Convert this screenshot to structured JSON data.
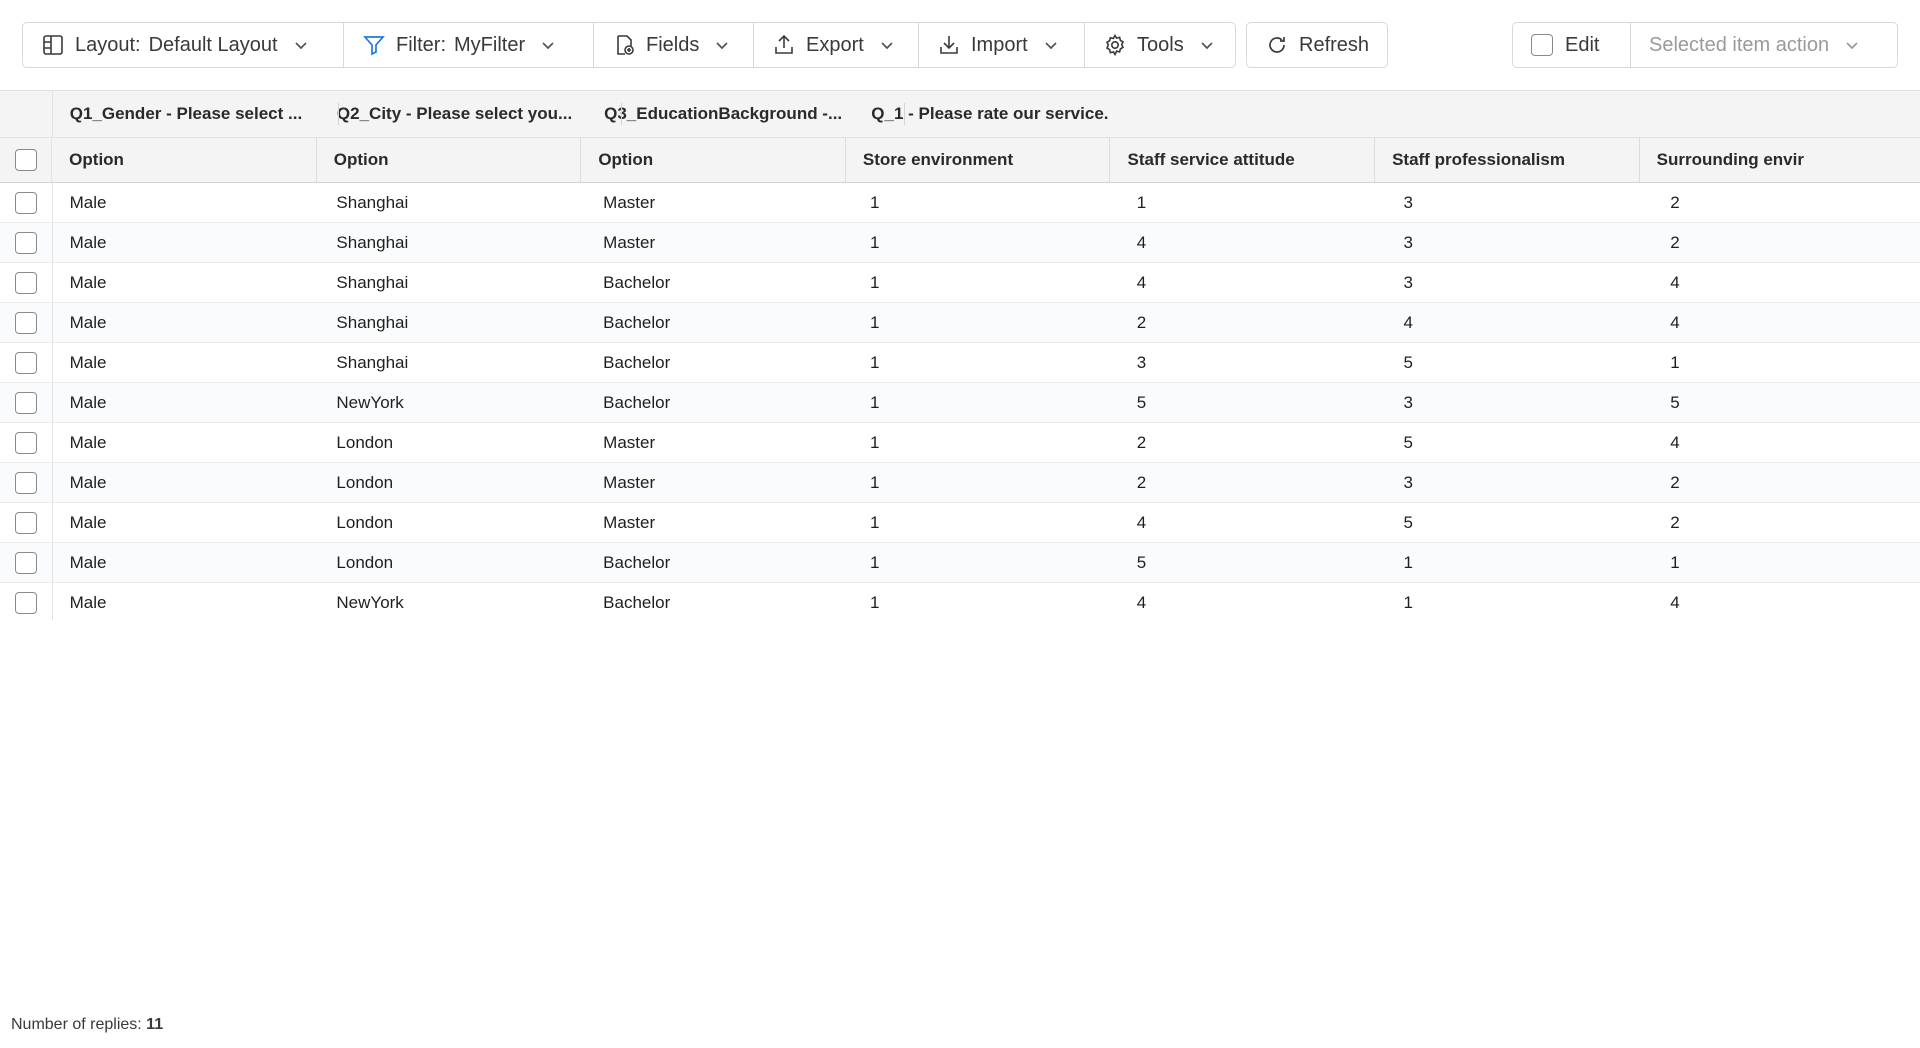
{
  "toolbar": {
    "layout": {
      "key": "Layout:",
      "value": "Default Layout"
    },
    "filter": {
      "key": "Filter:",
      "value": "MyFilter"
    },
    "fields": "Fields",
    "export": "Export",
    "import": "Import",
    "tools": "Tools",
    "refresh": "Refresh",
    "edit": "Edit",
    "selected_action": "Selected item action"
  },
  "accent_color": "#1f7ae0",
  "groups": [
    "Q1_Gender - Please select ...",
    "Q2_City - Please select you...",
    "Q3_EducationBackground -...",
    "Q_1 - Please rate our service."
  ],
  "headers": [
    "Option",
    "Option",
    "Option",
    "Store environment",
    "Staff service attitude",
    "Staff professionalism",
    "Surrounding envir"
  ],
  "rows": [
    [
      "Male",
      "Shanghai",
      "Master",
      "1",
      "1",
      "3",
      "2"
    ],
    [
      "Male",
      "Shanghai",
      "Master",
      "1",
      "4",
      "3",
      "2"
    ],
    [
      "Male",
      "Shanghai",
      "Bachelor",
      "1",
      "4",
      "3",
      "4"
    ],
    [
      "Male",
      "Shanghai",
      "Bachelor",
      "1",
      "2",
      "4",
      "4"
    ],
    [
      "Male",
      "Shanghai",
      "Bachelor",
      "1",
      "3",
      "5",
      "1"
    ],
    [
      "Male",
      "NewYork",
      "Bachelor",
      "1",
      "5",
      "3",
      "5"
    ],
    [
      "Male",
      "London",
      "Master",
      "1",
      "2",
      "5",
      "4"
    ],
    [
      "Male",
      "London",
      "Master",
      "1",
      "2",
      "3",
      "2"
    ],
    [
      "Male",
      "London",
      "Master",
      "1",
      "4",
      "5",
      "2"
    ],
    [
      "Male",
      "London",
      "Bachelor",
      "1",
      "5",
      "1",
      "1"
    ],
    [
      "Male",
      "NewYork",
      "Bachelor",
      "1",
      "4",
      "1",
      "4"
    ]
  ],
  "footer": {
    "label": "Number of replies:",
    "count": "11"
  }
}
